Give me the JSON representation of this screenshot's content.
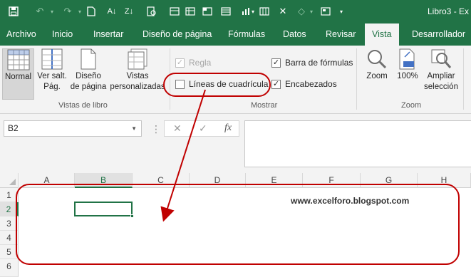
{
  "window": {
    "title": "Libro3 - Ex"
  },
  "qat": {
    "icons": [
      "save-icon",
      "undo-icon",
      "redo-icon",
      "new-file-icon",
      "sort-ascending-icon",
      "sort-descending-icon",
      "print-preview-icon",
      "form-icon",
      "freeze-panes-icon",
      "clear-icon",
      "remove-duplicates-icon",
      "shapes-icon"
    ]
  },
  "tabs": [
    "Archivo",
    "Inicio",
    "Insertar",
    "Diseño de página",
    "Fórmulas",
    "Datos",
    "Revisar",
    "Vista",
    "Desarrollador"
  ],
  "active_tab": "Vista",
  "ribbon": {
    "workbook_views": {
      "label": "Vistas de libro",
      "normal": "Normal",
      "page_break_line1": "Ver salt.",
      "page_break_line2": "Pág.",
      "page_layout_line1": "Diseño",
      "page_layout_line2": "de página",
      "custom_views_line1": "Vistas",
      "custom_views_line2": "personalizadas"
    },
    "show": {
      "label": "Mostrar",
      "ruler": "Regla",
      "ruler_checked": true,
      "ruler_enabled": false,
      "gridlines": "Líneas de cuadrícula",
      "gridlines_checked": false,
      "formula_bar": "Barra de fórmulas",
      "formula_bar_checked": true,
      "headings": "Encabezados",
      "headings_checked": true
    },
    "zoom": {
      "label": "Zoom",
      "zoom": "Zoom",
      "hundred": "100%",
      "zoom_to_selection_line1": "Ampliar",
      "zoom_to_selection_line2": "selección"
    }
  },
  "formula_bar": {
    "name_box": "B2",
    "cancel_symbol": "✕",
    "enter_symbol": "✓",
    "fx_symbol": "fx",
    "value": ""
  },
  "grid": {
    "columns": [
      "A",
      "B",
      "C",
      "D",
      "E",
      "F",
      "G",
      "H"
    ],
    "rows": [
      "1",
      "2",
      "3",
      "4",
      "5",
      "6"
    ],
    "selected_cell": "B2"
  },
  "watermark": "www.excelforo.blogspot.com",
  "colors": {
    "excel_green": "#217346",
    "annotation_red": "#c00000"
  }
}
